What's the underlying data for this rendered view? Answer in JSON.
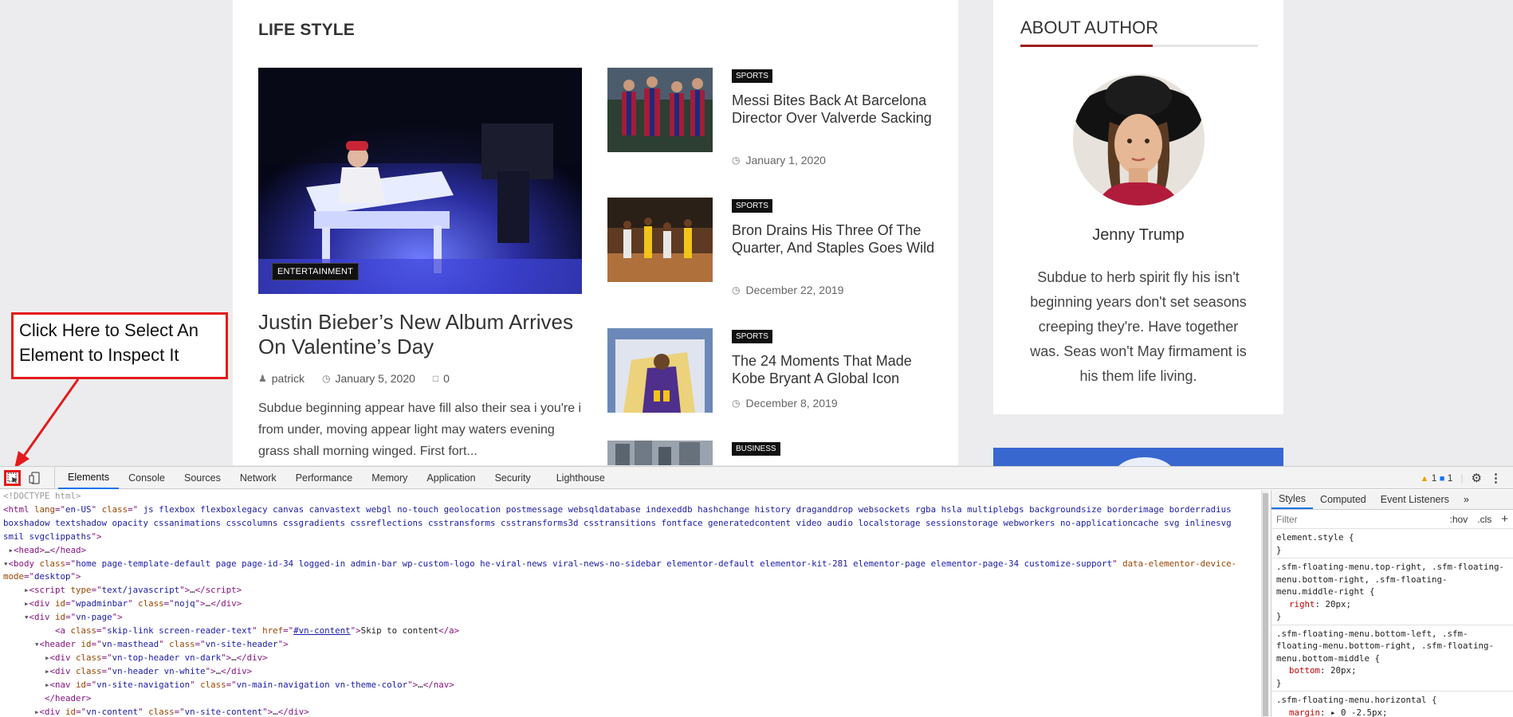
{
  "main": {
    "section_title": "LIFE STYLE",
    "featured": {
      "category": "ENTERTAINMENT",
      "title": "Justin Bieber’s New Album Arrives On Valentine’s Day",
      "author": "patrick",
      "date": "January 5, 2020",
      "comments": "0",
      "excerpt": "Subdue beginning appear have fill also their sea i you're i from under, moving appear light may waters evening grass shall morning winged. First fort..."
    },
    "side_posts": [
      {
        "category": "SPORTS",
        "title": "Messi Bites Back At Barcelona Director Over Valverde Sacking",
        "date": "January 1, 2020"
      },
      {
        "category": "SPORTS",
        "title": "Bron Drains His Three Of The Quarter, And Staples Goes Wild",
        "date": "December 22, 2019"
      },
      {
        "category": "SPORTS",
        "title": "The 24 Moments That Made Kobe Bryant A Global Icon",
        "date": "December 8, 2019"
      },
      {
        "category": "BUSINESS",
        "title": "",
        "date": ""
      }
    ]
  },
  "author_widget": {
    "heading": "ABOUT AUTHOR",
    "name": "Jenny Trump",
    "bio": "Subdue to herb spirit fly his isn't beginning years don't set seasons creeping they're. Have together was. Seas won't May firmament is his them life living."
  },
  "annotation": {
    "text": "Click Here to Select An Element to Inspect It",
    "color": "#e31b1b"
  },
  "devtools": {
    "tabs": [
      "Elements",
      "Console",
      "Sources",
      "Network",
      "Performance",
      "Memory",
      "Application",
      "Security",
      "Lighthouse"
    ],
    "active_tab": "Elements",
    "warnings": "1",
    "messages": "1",
    "styles_tabs": [
      "Styles",
      "Computed",
      "Event Listeners",
      "»"
    ],
    "filter_placeholder": "Filter",
    "hov": ":hov",
    "cls": ".cls",
    "dom": {
      "doctype": "<!DOCTYPE html>",
      "html_lang": "en-US",
      "html_class": " js flexbox flexboxlegacy canvas canvastext webgl no-touch geolocation postmessage websqldatabase indexeddb hashchange history draganddrop websockets rgba hsla multiplebgs backgroundsize borderimage borderradius boxshadow textshadow opacity cssanimations csscolumns cssgradients cssreflections csstransforms csstransforms3d csstransitions fontface generatedcontent video audio localstorage sessionstorage webworkers no-applicationcache svg inlinesvg smil svgclippaths",
      "body_class": "home page-template-default page page-id-34 logged-in admin-bar wp-custom-logo he-viral-news viral-news-no-sidebar elementor-default elementor-kit-281 elementor-page elementor-page-34 customize-support",
      "body_attr_name": "data-elementor-device-mode",
      "body_attr_val": "desktop",
      "script_type": "text/javascript",
      "adminbar_id": "wpadminbar",
      "adminbar_class": "nojq",
      "page_id": "vn-page",
      "skip_class": "skip-link screen-reader-text",
      "skip_href": "#vn-content",
      "skip_text": "Skip to content",
      "header_id": "vn-masthead",
      "header_class": "vn-site-header",
      "top_header_class": "vn-top-header vn-dark",
      "header_white_class": "vn-header vn-white",
      "nav_id": "vn-site-navigation",
      "nav_class": "vn-main-navigation vn-theme-color",
      "content_id": "vn-content",
      "content_class": "vn-site-content"
    },
    "styles": {
      "element_style": "element.style {",
      "rules": [
        {
          "selector": ".sfm-floating-menu.top-right, .sfm-floating-menu.bottom-right, .sfm-floating-menu.middle-right {",
          "prop": "right",
          "value": "20px;"
        },
        {
          "selector": ".sfm-floating-menu.bottom-left, .sfm-floating-menu.bottom-right, .sfm-floating-menu.bottom-middle {",
          "prop": "bottom",
          "value": "20px;"
        },
        {
          "selector": ".sfm-floating-menu.horizontal {",
          "prop": "margin",
          "value": "▸ 0 -2.5px;"
        }
      ]
    }
  }
}
